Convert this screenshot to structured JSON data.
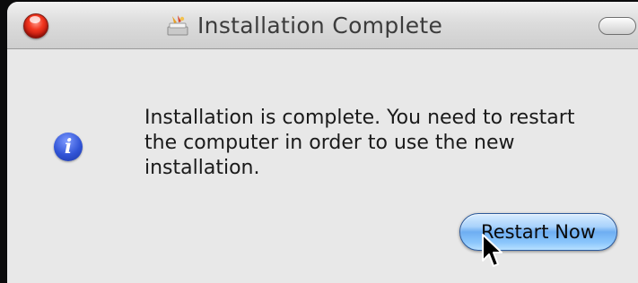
{
  "window": {
    "title": "Installation Complete"
  },
  "dialog": {
    "message": "Installation is complete. You need to restart\nthe computer in order to use the new\ninstallation.",
    "icon": "info-icon",
    "icon_glyph": "i",
    "restart_button_label": "Restart Now"
  },
  "colors": {
    "close_button": "#e0301e",
    "info_icon": "#3154d6",
    "default_button": "#6eaef2"
  }
}
